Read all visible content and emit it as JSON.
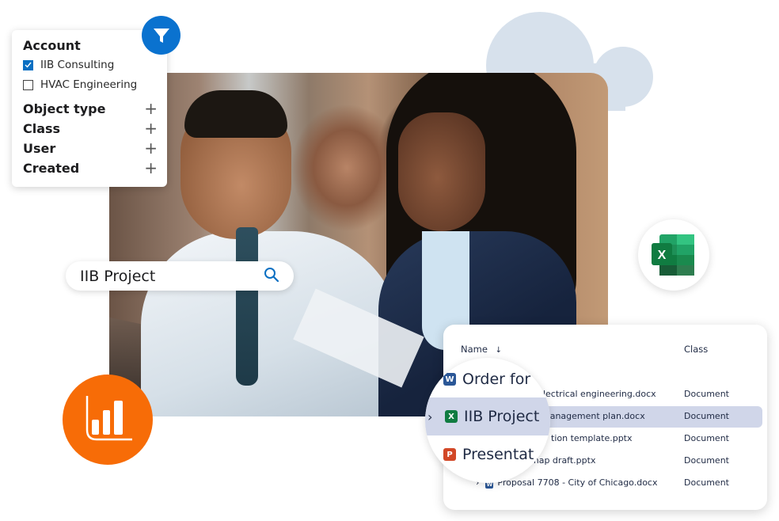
{
  "filter_panel": {
    "account_heading": "Account",
    "account_options": [
      {
        "label": "IIB Consulting",
        "checked": true
      },
      {
        "label": "HVAC Engineering",
        "checked": false
      }
    ],
    "sections": [
      {
        "label": "Object type",
        "icon": "plus-icon"
      },
      {
        "label": "Class",
        "icon": "plus-icon"
      },
      {
        "label": "User",
        "icon": "plus-icon"
      },
      {
        "label": "Created",
        "icon": "plus-icon"
      }
    ],
    "filter_icon": "filter-icon",
    "accent_color": "#0a72cf"
  },
  "search": {
    "value": "IIB Project",
    "icon": "search-icon"
  },
  "badges": {
    "analytics_icon": "bar-chart-icon",
    "analytics_color": "#f76c07",
    "excel_icon": "excel-icon"
  },
  "results": {
    "columns": {
      "name": "Name",
      "name_sort": "↓",
      "class": "Class"
    },
    "rows": [
      {
        "name": "Order form",
        "class": "",
        "type": "word"
      },
      {
        "name": "Electrical engineering.docx",
        "class": "Document",
        "type": "word"
      },
      {
        "name": "IIB Project management plan.docx",
        "class": "Document",
        "type": "excel",
        "selected": true
      },
      {
        "name": "Presentation template.pptx",
        "class": "Document",
        "type": "powerpoint"
      },
      {
        "name": "Roadmap draft.pptx",
        "class": "Document",
        "type": "powerpoint"
      },
      {
        "name": "Proposal 7708 - City of Chicago.docx",
        "class": "Document",
        "type": "word"
      }
    ],
    "visible_text": {
      "row1_name": "Electrical engineering.docx",
      "row2_name": "management plan.docx",
      "row3_name": "tion template.pptx",
      "row4_name": "map draft.pptx",
      "row5_name": "Proposal 7708 - City of Chicago.docx"
    },
    "highlight_color": "#d0d6e9"
  },
  "magnifier": {
    "rows": [
      {
        "label": "Order for",
        "badge": "W"
      },
      {
        "label": "IIB Project",
        "badge": "X",
        "expander": "›"
      },
      {
        "label": "Presentat",
        "badge": "P"
      }
    ]
  }
}
